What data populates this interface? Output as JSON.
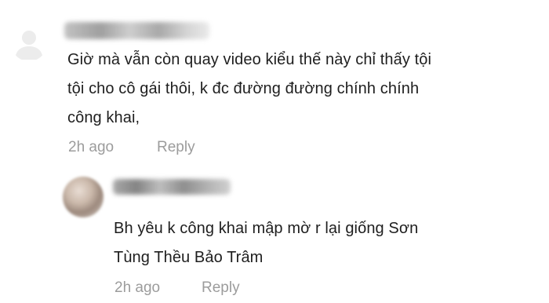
{
  "comments": [
    {
      "avatar_icon": "default-user-icon",
      "text_lines": [
        "Giờ mà vẫn còn quay video kiểu thế này chỉ thấy tội",
        "tội cho cô gái thôi, k đc đường đường chính chính",
        "công khai,"
      ],
      "time": "2h ago",
      "reply_label": "Reply"
    },
    {
      "text_lines": [
        "Bh yêu k công khai mập mờ r lại giống Sơn",
        "Tùng Thều Bảo Trâm"
      ],
      "time": "2h ago",
      "reply_label": "Reply"
    }
  ]
}
